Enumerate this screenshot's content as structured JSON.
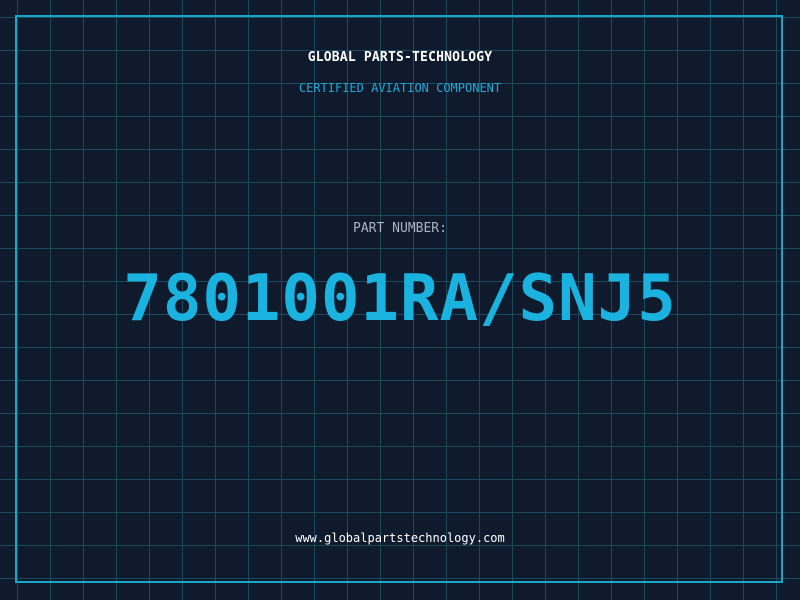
{
  "header": {
    "company": "GLOBAL PARTS-TECHNOLOGY",
    "tagline": "CERTIFIED AVIATION COMPONENT"
  },
  "part": {
    "label": "PART NUMBER:",
    "number": "7801001RA/SNJ5"
  },
  "footer": {
    "website": "www.globalpartstechnology.com"
  },
  "colors": {
    "background": "#0f1a2d",
    "grid": "#1b4a5e",
    "accent": "#1ab2de",
    "border": "#1aa6c8"
  }
}
